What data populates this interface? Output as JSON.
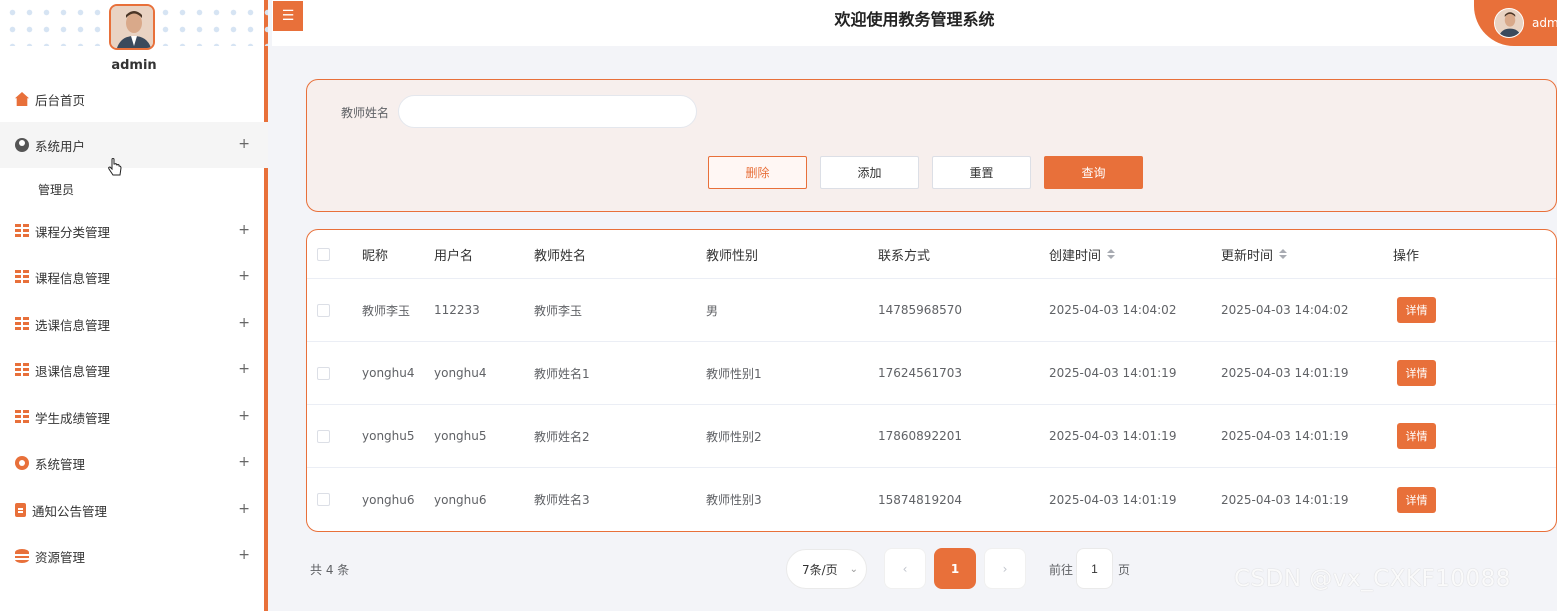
{
  "sidebar": {
    "username": "admin",
    "avatar_icon": "user-avatar-photo",
    "items": [
      {
        "label": "后台首页",
        "icon": "home-icon",
        "expandable": false
      },
      {
        "label": "系统用户",
        "icon": "user-circle-icon",
        "expandable": true,
        "expand_glyph": "+",
        "active": true,
        "children": [
          {
            "label": "管理员"
          }
        ]
      },
      {
        "label": "课程分类管理",
        "icon": "grid-icon",
        "expandable": true,
        "expand_glyph": "+"
      },
      {
        "label": "课程信息管理",
        "icon": "grid-icon",
        "expandable": true,
        "expand_glyph": "+"
      },
      {
        "label": "选课信息管理",
        "icon": "grid-icon",
        "expandable": true,
        "expand_glyph": "+"
      },
      {
        "label": "退课信息管理",
        "icon": "grid-icon",
        "expandable": true,
        "expand_glyph": "+"
      },
      {
        "label": "学生成绩管理",
        "icon": "grid-icon",
        "expandable": true,
        "expand_glyph": "+"
      },
      {
        "label": "系统管理",
        "icon": "gear-icon",
        "expandable": true,
        "expand_glyph": "+"
      },
      {
        "label": "通知公告管理",
        "icon": "document-icon",
        "expandable": true,
        "expand_glyph": "+"
      },
      {
        "label": "资源管理",
        "icon": "database-icon",
        "expandable": true,
        "expand_glyph": "+"
      }
    ]
  },
  "header": {
    "menu_toggle_glyph": "☰",
    "title": "欢迎使用教务管理系统",
    "user_label": "admin"
  },
  "search": {
    "label": "教师姓名",
    "value": "",
    "placeholder": "",
    "buttons": {
      "delete": "删除",
      "add": "添加",
      "reset": "重置",
      "query": "查询"
    }
  },
  "table": {
    "columns": [
      "昵称",
      "用户名",
      "教师姓名",
      "教师性别",
      "联系方式",
      "创建时间",
      "更新时间",
      "操作"
    ],
    "action_label": "详情",
    "rows": [
      {
        "nickname": "教师李玉",
        "username": "112233",
        "teacher_name": "教师李玉",
        "gender": "男",
        "phone": "14785968570",
        "created": "2025-04-03 14:04:02",
        "updated": "2025-04-03 14:04:02"
      },
      {
        "nickname": "yonghu4",
        "username": "yonghu4",
        "teacher_name": "教师姓名1",
        "gender": "教师性别1",
        "phone": "17624561703",
        "created": "2025-04-03 14:01:19",
        "updated": "2025-04-03 14:01:19"
      },
      {
        "nickname": "yonghu5",
        "username": "yonghu5",
        "teacher_name": "教师姓名2",
        "gender": "教师性别2",
        "phone": "17860892201",
        "created": "2025-04-03 14:01:19",
        "updated": "2025-04-03 14:01:19"
      },
      {
        "nickname": "yonghu6",
        "username": "yonghu6",
        "teacher_name": "教师姓名3",
        "gender": "教师性别3",
        "phone": "15874819204",
        "created": "2025-04-03 14:01:19",
        "updated": "2025-04-03 14:01:19"
      }
    ]
  },
  "pagination": {
    "total_text": "共 4 条",
    "page_size": "7条/页",
    "current_page": "1",
    "prev_glyph": "‹",
    "next_glyph": "›",
    "caret_glyph": "⌄",
    "goto_prefix": "前往",
    "goto_value": "1",
    "goto_suffix": "页"
  },
  "watermark": "CSDN @vx_CXKF10088",
  "colors": {
    "accent": "#e8703a",
    "search_panel_bg": "#f7efed",
    "page_bg": "#f3f4f8"
  }
}
